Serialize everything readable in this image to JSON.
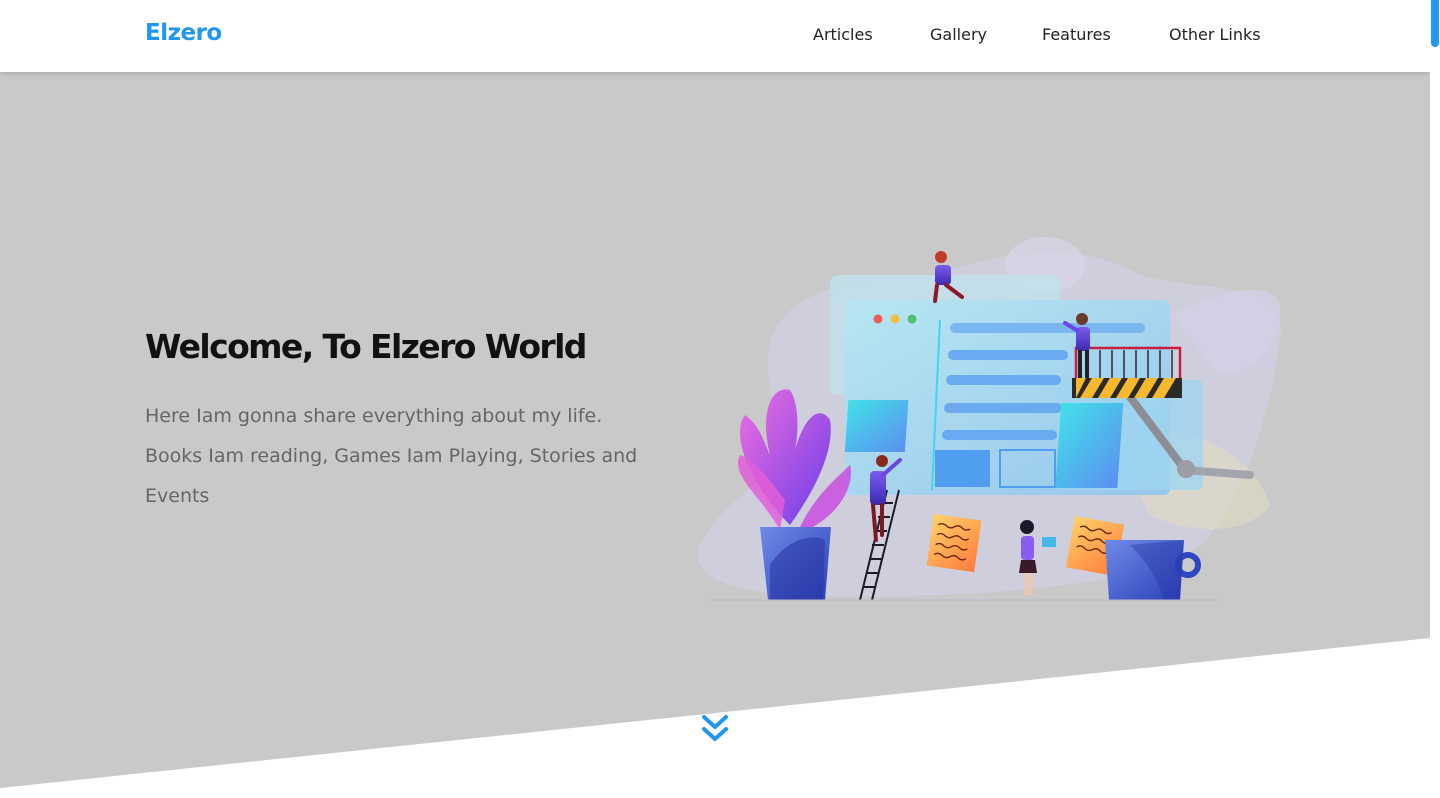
{
  "header": {
    "logo": "Elzero",
    "nav": [
      {
        "label": "Articles",
        "name": "nav-articles"
      },
      {
        "label": "Gallery",
        "name": "nav-gallery"
      },
      {
        "label": "Features",
        "name": "nav-features"
      },
      {
        "label": "Other Links",
        "name": "nav-other-links"
      }
    ]
  },
  "hero": {
    "title": "Welcome, To Elzero World",
    "description": "Here Iam gonna share everything about my life. Books Iam reading, Games Iam Playing, Stories and Events",
    "illustration_icon": "team-building-website-illustration",
    "scroll_icon": "double-chevron-down-icon"
  },
  "colors": {
    "accent": "#2196f3",
    "hero_background": "#c9c9c9",
    "title": "#111111",
    "body_text": "#666666"
  }
}
